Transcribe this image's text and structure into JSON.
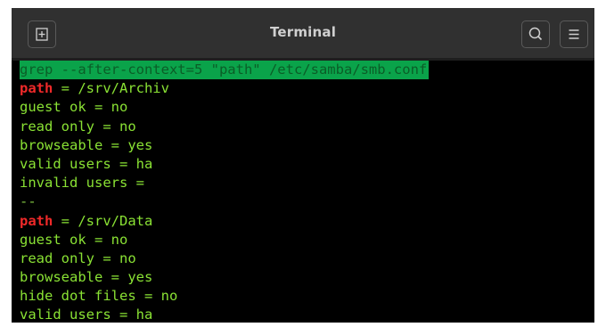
{
  "window": {
    "title": "Terminal"
  },
  "icons": {
    "new_tab": "new-tab-icon",
    "search": "search-icon",
    "menu": "hamburger-menu-icon"
  },
  "colors": {
    "command_highlight": "#0aa34a",
    "match_red": "#ef2929",
    "text_green": "#8ae234",
    "background": "#000000"
  },
  "terminal": {
    "command": "grep --after-context=5 \"path\" /etc/samba/smb.conf",
    "block1": {
      "match_key": "path",
      "match_rest": " = /srv/Archiv",
      "lines": [
        "guest ok = no",
        "read only = no",
        "browseable = yes",
        "valid users = ha",
        "invalid users ="
      ]
    },
    "separator": "--",
    "block2": {
      "match_key": "path",
      "match_rest": " = /srv/Data",
      "lines": [
        "guest ok = no",
        "read only = no",
        "browseable = yes",
        "hide dot files = no",
        "valid users = ha"
      ]
    }
  }
}
